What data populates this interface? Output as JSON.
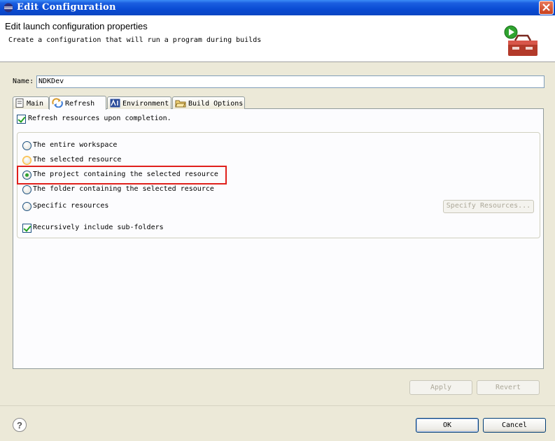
{
  "window": {
    "title": "Edit Configuration"
  },
  "header": {
    "title": "Edit launch configuration properties",
    "description": "Create a configuration that will run a program during builds"
  },
  "name_field": {
    "label": "Name:",
    "value": "NDKDev"
  },
  "tabs": [
    {
      "label": "Main",
      "selected": false,
      "icon": "main-icon"
    },
    {
      "label": "Refresh",
      "selected": true,
      "icon": "refresh-icon"
    },
    {
      "label": "Environment",
      "selected": false,
      "icon": "environment-icon"
    },
    {
      "label": "Build Options",
      "selected": false,
      "icon": "build-options-icon"
    }
  ],
  "refresh_tab": {
    "refresh_on_completion": {
      "label": "Refresh resources upon completion.",
      "checked": true
    },
    "scope_options": [
      {
        "label": "The entire workspace",
        "selected": false
      },
      {
        "label": "The selected resource",
        "selected": false
      },
      {
        "label": "The project containing the selected resource",
        "selected": true
      },
      {
        "label": "The folder containing the selected resource",
        "selected": false
      },
      {
        "label": "Specific resources",
        "selected": false
      }
    ],
    "specify_resources_button": "Specify Resources...",
    "recursive": {
      "label": "Recursively include sub-folders",
      "checked": true
    }
  },
  "apply_button": "Apply",
  "revert_button": "Revert",
  "ok_button": "OK",
  "cancel_button": "Cancel",
  "colors": {
    "titlebar": "#0a4bd3",
    "highlight_border": "#e0201c",
    "dialog_bg": "#ece9d8"
  }
}
